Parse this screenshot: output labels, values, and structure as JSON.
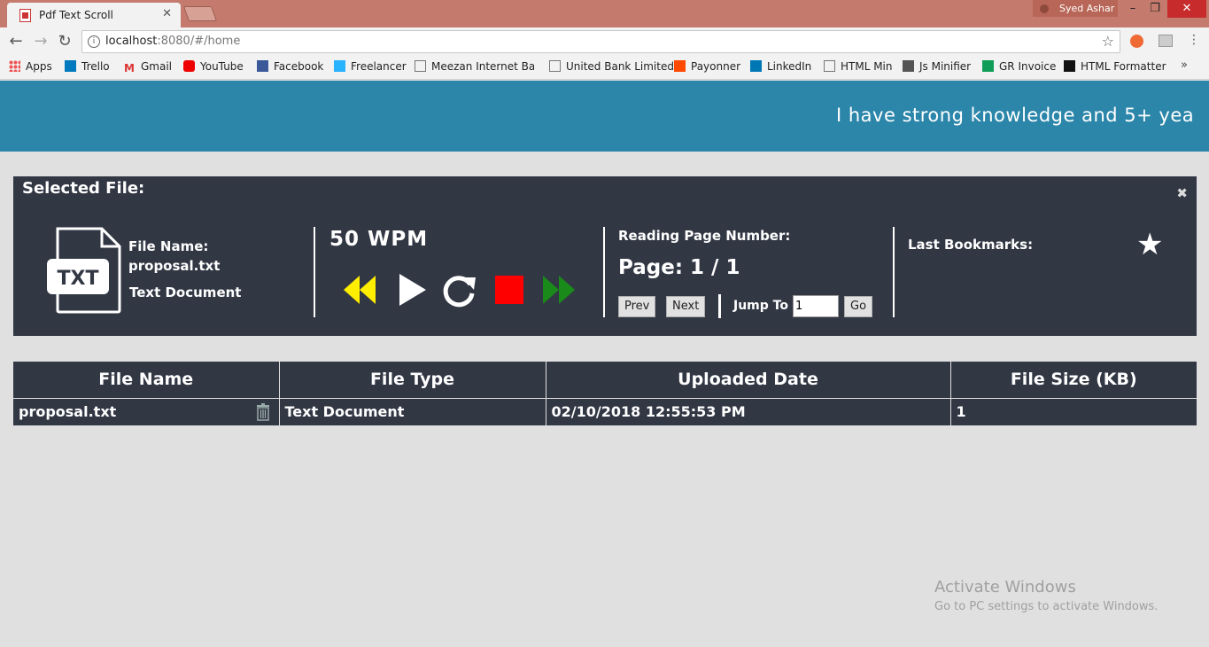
{
  "browser": {
    "tab_title": "Pdf Text Scroll",
    "profile_name": "Syed Ashar",
    "url_host": "localhost",
    "url_rest": ":8080/#/home",
    "bookmarks": [
      "Apps",
      "Trello",
      "Gmail",
      "YouTube",
      "Facebook",
      "Freelancer",
      "Meezan Internet Ban",
      "United Bank Limited",
      "Payonner",
      "LinkedIn",
      "HTML Min",
      "Js Minifier",
      "GR Invoice",
      "HTML Formatter"
    ]
  },
  "banner": {
    "marquee_text": "I have strong knowledge and 5+ yea"
  },
  "panel": {
    "title": "Selected File:",
    "file_icon_label": "TXT",
    "file_name_label": "File Name:",
    "file_name": "proposal.txt",
    "file_type": "Text Document",
    "wpm": "50 WPM",
    "reading_label": "Reading Page Number:",
    "page_text": "Page: 1 / 1",
    "prev_label": "Prev",
    "next_label": "Next",
    "jump_label": "Jump To",
    "jump_value": "1",
    "go_label": "Go",
    "bookmarks_label": "Last Bookmarks:"
  },
  "colors": {
    "banner": "#2b86aa",
    "panel": "#323744",
    "rewind": "#ffee00",
    "stop": "#ff0000",
    "forward": "#1a8a1a"
  },
  "table": {
    "headers": [
      "File Name",
      "File Type",
      "Uploaded Date",
      "File Size (KB)"
    ],
    "rows": [
      {
        "name": "proposal.txt",
        "type": "Text Document",
        "date": "02/10/2018 12:55:53 PM",
        "size": "1"
      }
    ]
  },
  "windows": {
    "activate_title": "Activate Windows",
    "activate_sub": "Go to PC settings to activate Windows."
  }
}
